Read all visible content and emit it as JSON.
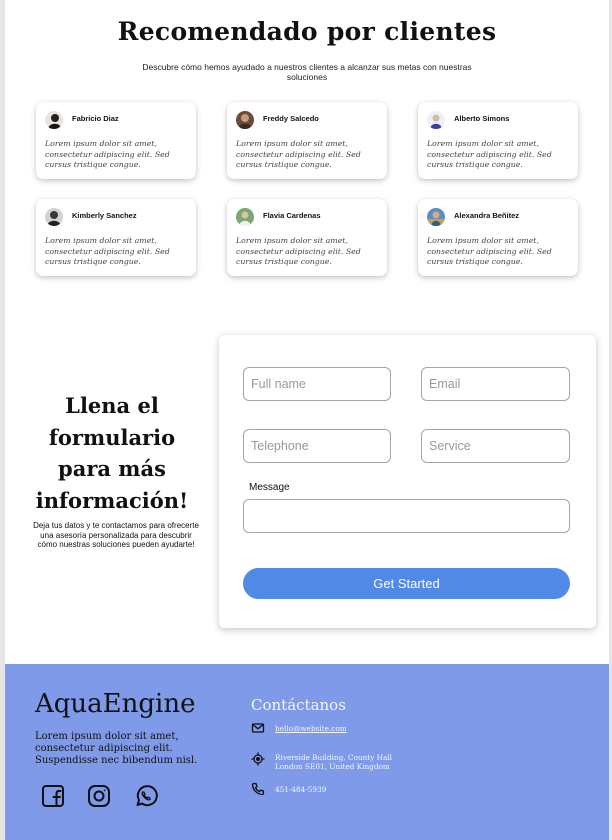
{
  "testimonials": {
    "title": "Recomendado por clientes",
    "subtitle": "Descubre cómo hemos ayudado a nuestros clientes a alcanzar sus metas con nuestras soluciones",
    "items": [
      {
        "name": "Fabricio Diaz",
        "quote": "Lorem ipsum dolor sit amet, consectetur adipiscing elit. Sed cursus tristique congue."
      },
      {
        "name": "Freddy Salcedo",
        "quote": "Lorem ipsum dolor sit amet, consectetur adipiscing elit. Sed cursus tristique congue."
      },
      {
        "name": "Alberto Simons",
        "quote": "Lorem ipsum dolor sit amet, consectetur adipiscing elit. Sed cursus tristique congue."
      },
      {
        "name": "Kimberly Sanchez",
        "quote": "Lorem ipsum dolor sit amet, consectetur adipiscing elit. Sed cursus tristique congue."
      },
      {
        "name": "Flavia Cardenas",
        "quote": "Lorem ipsum dolor sit amet, consectetur adipiscing elit. Sed cursus tristique congue."
      },
      {
        "name": "Alexandra Beñitez",
        "quote": "Lorem ipsum dolor sit amet, consectetur adipiscing elit. Sed cursus tristique congue."
      }
    ]
  },
  "cta": {
    "heading": "Llena el formulario para más información!",
    "text": "Deja tus datos y te contactamos para ofrecerte una asesoría personalizada para descubrir cómo nuestras soluciones pueden ayudarte!"
  },
  "form": {
    "full_name_placeholder": "Full name",
    "email_placeholder": "Email",
    "telephone_placeholder": "Telephone",
    "service_placeholder": "Service",
    "message_label": "Message",
    "submit_label": "Get Started"
  },
  "footer": {
    "brand": "AquaEngine",
    "brand_text": "Lorem ipsum dolor sit amet, consectetur adipiscing elit. Suspendisse nec bibendum nisl.",
    "social_icons": [
      "facebook-icon",
      "instagram-icon",
      "whatsapp-icon"
    ],
    "contact_title": "Contáctanos",
    "email": "hello@website.com",
    "address": "Riverside Building, County Hall London SE01, United Kingdom",
    "phone": "451-484-5939"
  },
  "colors": {
    "accent_button": "#508ae6",
    "footer_bg": "#7f9ae8"
  }
}
